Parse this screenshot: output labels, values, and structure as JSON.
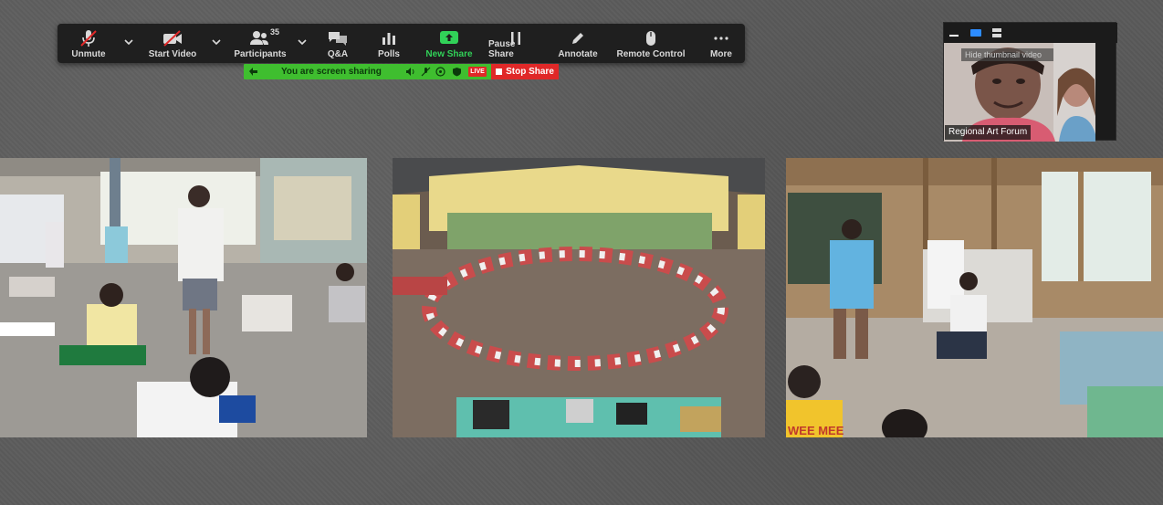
{
  "toolbar": {
    "buttons": [
      {
        "label": "Unmute",
        "icon": "mic-muted-icon"
      },
      {
        "label": "Start Video",
        "icon": "video-off-icon"
      },
      {
        "label": "Participants",
        "icon": "participants-icon",
        "count": "35"
      },
      {
        "label": "Q&A",
        "icon": "qa-icon"
      },
      {
        "label": "Polls",
        "icon": "polls-icon"
      },
      {
        "label": "New Share",
        "icon": "share-up-icon"
      },
      {
        "label": "Pause Share",
        "icon": "pause-icon"
      },
      {
        "label": "Annotate",
        "icon": "pencil-icon"
      },
      {
        "label": "Remote Control",
        "icon": "mouse-icon"
      },
      {
        "label": "More",
        "icon": "more-dots-icon"
      }
    ]
  },
  "share_bar": {
    "text": "You are screen sharing",
    "live_label": "LIVE",
    "stop_label": "Stop Share"
  },
  "thumbnail": {
    "name": "Regional Art Forum",
    "tooltip": "Hide thumbnail video"
  },
  "colors": {
    "accent_green": "#3fbe2f",
    "stop_red": "#e02828",
    "toolbar_bg": "#1f1f1f"
  },
  "photos": {
    "third": {
      "shirt_text": "WEE MEE"
    }
  }
}
